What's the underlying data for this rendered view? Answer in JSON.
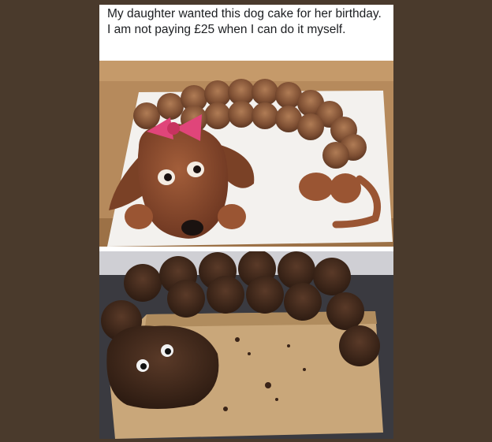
{
  "post": {
    "caption": "My daughter wanted this dog cake for her birthday. I am not paying £25 when I can do it myself."
  },
  "photos": {
    "top": {
      "subject": "professional-dachshund-cupcake-cake"
    },
    "bottom": {
      "subject": "homemade-dachshund-cupcake-cake"
    }
  },
  "colors": {
    "frame": "#4a3a2c",
    "caption_text": "#1c1e21",
    "fondant_brown": "#8a4a2e",
    "frosting": "#8a5a3a",
    "bow_pink": "#e0457a",
    "board_white": "#f3f1ee",
    "wood": "#c9a77a",
    "chocolate": "#3a2418"
  }
}
